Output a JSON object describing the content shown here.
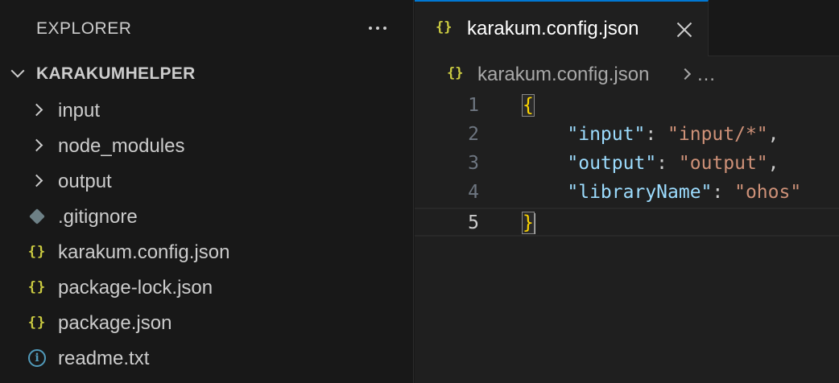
{
  "explorer": {
    "title": "EXPLORER",
    "more_icon": "ellipsis-icon",
    "root_folder": "KARAKUMHELPER",
    "items": [
      {
        "label": "input",
        "type": "folder",
        "icon": "chevron-right-icon"
      },
      {
        "label": "node_modules",
        "type": "folder",
        "icon": "chevron-right-icon"
      },
      {
        "label": "output",
        "type": "folder",
        "icon": "chevron-right-icon"
      },
      {
        "label": ".gitignore",
        "type": "file",
        "icon": "git-icon"
      },
      {
        "label": "karakum.config.json",
        "type": "file",
        "icon": "json-icon"
      },
      {
        "label": "package-lock.json",
        "type": "file",
        "icon": "json-icon"
      },
      {
        "label": "package.json",
        "type": "file",
        "icon": "json-icon"
      },
      {
        "label": "readme.txt",
        "type": "file",
        "icon": "info-icon"
      }
    ]
  },
  "editor": {
    "tab": {
      "label": "karakum.config.json",
      "icon": "json-icon",
      "close_icon": "close-icon"
    },
    "breadcrumb": {
      "file": "karakum.config.json",
      "more": "…"
    },
    "json_icon_text": "{}",
    "lines": [
      {
        "number": "1",
        "open": "{"
      },
      {
        "number": "2",
        "key": "\"input\"",
        "sep": ": ",
        "value": "\"input/*\"",
        "end": ","
      },
      {
        "number": "3",
        "key": "\"output\"",
        "sep": ": ",
        "value": "\"output\"",
        "end": ","
      },
      {
        "number": "4",
        "key": "\"libraryName\"",
        "sep": ": ",
        "value": "\"ohos\"",
        "end": ""
      },
      {
        "number": "5",
        "close": "}"
      }
    ]
  },
  "colors": {
    "json_icon": "#cbcb41",
    "key": "#9cdcfe",
    "string": "#ce9178",
    "brace": "#ffd700",
    "tab_accent": "#0078d4"
  }
}
